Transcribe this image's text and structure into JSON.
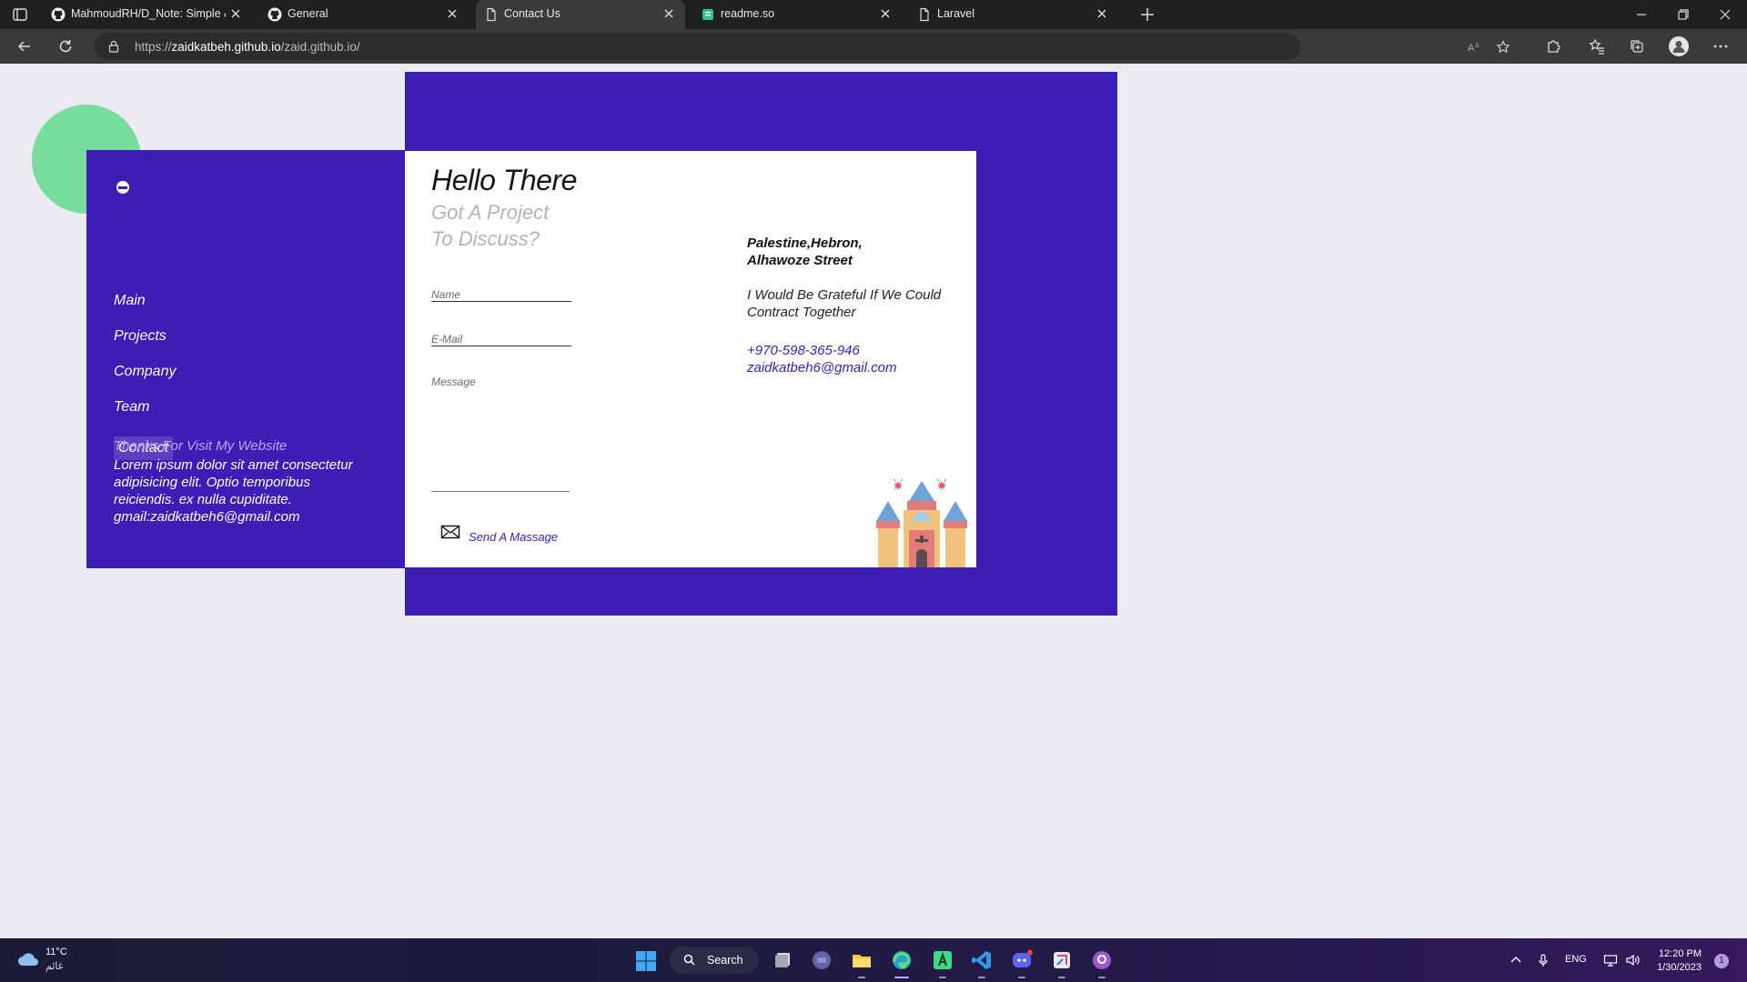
{
  "browser": {
    "tabs": [
      {
        "title": "MahmoudRH/D_Note: Simple &",
        "icon": "github-icon",
        "active": false
      },
      {
        "title": "General",
        "icon": "github-icon",
        "active": false
      },
      {
        "title": "Contact Us",
        "icon": "page-icon",
        "active": true
      },
      {
        "title": "readme.so",
        "icon": "readme-icon",
        "active": false
      },
      {
        "title": "Laravel",
        "icon": "page-icon",
        "active": false
      }
    ],
    "url": {
      "scheme": "https://",
      "host": "zaidkatbeh.github.io",
      "path": "/zaid.github.io/"
    }
  },
  "sidebar": {
    "nav": [
      {
        "label": "Main",
        "active": false
      },
      {
        "label": "Projects",
        "active": false
      },
      {
        "label": "Company",
        "active": false
      },
      {
        "label": "Team",
        "active": false
      },
      {
        "label": "Contact",
        "active": true
      }
    ],
    "thanks": "Thanks For Visit My Website",
    "lorem_lines": [
      "Lorem ipsum dolor sit amet consectetur",
      "adipisicing elit. Optio temporibus",
      "reiciendis. ex nulla cupiditate.",
      "gmail:zaidkatbeh6@gmail.com"
    ]
  },
  "contact": {
    "heading": "Hello There",
    "subheading_lines": [
      "Got A Project",
      "To Discuss?"
    ],
    "form": {
      "name_placeholder": "Name",
      "email_placeholder": "E-Mail",
      "message_placeholder": "Message",
      "send_label": "Send A Massage"
    },
    "address_lines": [
      "Palestine,Hebron,",
      "Alhawoze Street"
    ],
    "grateful_lines": [
      "I Would Be Grateful If We Could",
      "Contract Together"
    ],
    "phone": "+970-598-365-946",
    "email": "zaidkatbeh6@gmail.com"
  },
  "colors": {
    "brand": "#3e1cb6",
    "accent_blob": "#76dd9c",
    "page_bg": "#ecebf4"
  },
  "taskbar": {
    "weather": {
      "temp": "11°C",
      "desc": "غائم"
    },
    "search_label": "Search",
    "apps": [
      "task-view-icon",
      "chat-icon",
      "file-explorer-icon",
      "edge-icon",
      "android-studio-icon",
      "vscode-icon",
      "discord-icon",
      "snipping-tool-icon",
      "github-desktop-icon"
    ],
    "language": "ENG",
    "time": "12:20 PM",
    "date": "1/30/2023",
    "notification_count": "1"
  }
}
